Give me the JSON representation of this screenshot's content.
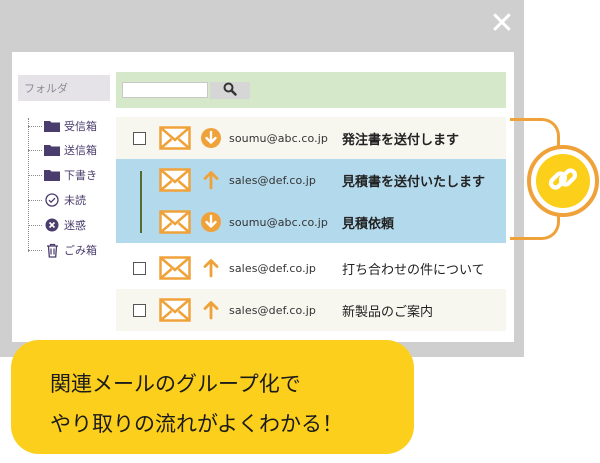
{
  "window": {
    "close_glyph": "✕"
  },
  "sidebar": {
    "header": "フォルダ",
    "items": [
      {
        "label": "受信箱",
        "icon": "folder-icon"
      },
      {
        "label": "送信箱",
        "icon": "folder-icon"
      },
      {
        "label": "下書き",
        "icon": "folder-icon"
      },
      {
        "label": "未読",
        "icon": "check-circle-icon"
      },
      {
        "label": "迷惑",
        "icon": "x-circle-icon"
      },
      {
        "label": "ごみ箱",
        "icon": "trash-icon"
      }
    ]
  },
  "search": {
    "value": "",
    "placeholder": "",
    "button_icon": "search-icon"
  },
  "messages": [
    {
      "sender": "soumu@abc.co.jp",
      "subject": "発注書を送付します",
      "priority": "down",
      "grouped": true
    },
    {
      "sender": "sales@def.co.jp",
      "subject": "見積書を送付いたします",
      "priority": "up",
      "grouped": true
    },
    {
      "sender": "soumu@abc.co.jp",
      "subject": "見積依頼",
      "priority": "down",
      "grouped": true
    },
    {
      "sender": "sales@def.co.jp",
      "subject": "打ち合わせの件について",
      "priority": "up",
      "grouped": false
    },
    {
      "sender": "sales@def.co.jp",
      "subject": "新製品のご案内",
      "priority": "up",
      "grouped": false
    }
  ],
  "link_icon": "link-icon",
  "callout": {
    "line1": "関連メールのグループ化で",
    "line2": "やり取りの流れがよくわかる！"
  },
  "colors": {
    "accent_orange": "#f0a23a",
    "accent_yellow": "#fbcf1c",
    "thread_blue": "#b3d9ec",
    "search_green": "#d5e8c9",
    "folder_purple": "#4a3c6c"
  }
}
